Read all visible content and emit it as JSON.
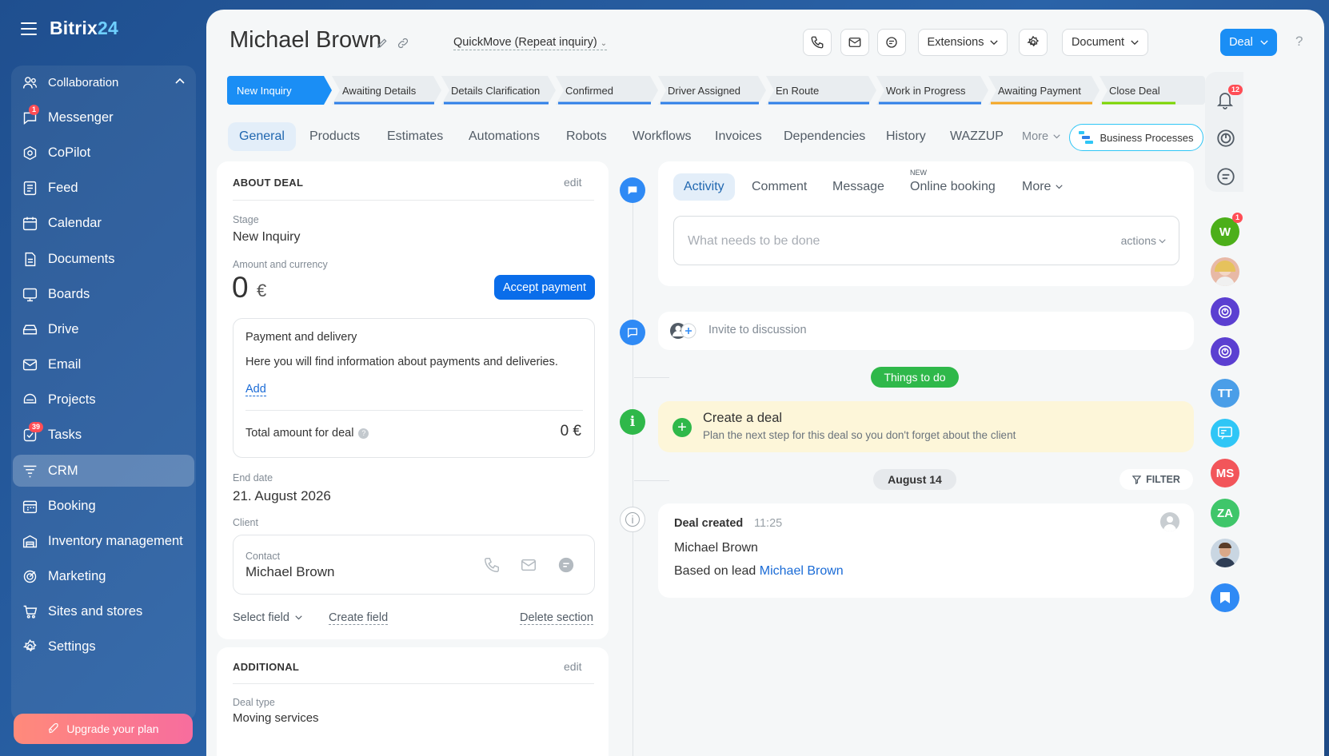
{
  "app": {
    "logo_text": "Bitrix24",
    "logo_main": "Bitrix",
    "logo_num": "24"
  },
  "sidebar": {
    "group_label": "Collaboration",
    "items": [
      {
        "label": "Messenger",
        "badge": "1"
      },
      {
        "label": "CoPilot"
      },
      {
        "label": "Feed"
      },
      {
        "label": "Calendar"
      },
      {
        "label": "Documents"
      },
      {
        "label": "Boards"
      },
      {
        "label": "Drive"
      },
      {
        "label": "Email"
      },
      {
        "label": "Projects"
      },
      {
        "label": "Tasks",
        "badge": "39"
      },
      {
        "label": "CRM"
      },
      {
        "label": "Booking"
      },
      {
        "label": "Inventory management"
      },
      {
        "label": "Marketing"
      },
      {
        "label": "Sites and stores"
      },
      {
        "label": "Settings"
      }
    ],
    "upgrade_label": "Upgrade your plan"
  },
  "header": {
    "title": "Michael Brown",
    "category": "QuickMove (Repeat inquiry)",
    "extensions_label": "Extensions",
    "document_label": "Document",
    "deal_label": "Deal",
    "help": "?"
  },
  "stages": [
    {
      "label": "New Inquiry",
      "color": "#1a8ef5",
      "active": true
    },
    {
      "label": "Awaiting Details",
      "color": "#2f80e8"
    },
    {
      "label": "Details Clarification",
      "color": "#2f80e8"
    },
    {
      "label": "Confirmed",
      "color": "#2f80e8"
    },
    {
      "label": "Driver Assigned",
      "color": "#2f80e8"
    },
    {
      "label": "En Route",
      "color": "#2f80e8"
    },
    {
      "label": "Work in Progress",
      "color": "#2f80e8"
    },
    {
      "label": "Awaiting Payment",
      "color": "#f5a623"
    },
    {
      "label": "Close Deal",
      "color": "#7bd500"
    }
  ],
  "tabs": [
    {
      "label": "General"
    },
    {
      "label": "Products"
    },
    {
      "label": "Estimates"
    },
    {
      "label": "Automations"
    },
    {
      "label": "Robots"
    },
    {
      "label": "Workflows"
    },
    {
      "label": "Invoices"
    },
    {
      "label": "Dependencies"
    },
    {
      "label": "History"
    },
    {
      "label": "WAZZUP"
    },
    {
      "label": "More"
    }
  ],
  "business_processes_label": "Business Processes",
  "about": {
    "section_title": "ABOUT DEAL",
    "edit_label": "edit",
    "stage_label": "Stage",
    "stage_value": "New Inquiry",
    "amount_label": "Amount and currency",
    "amount_value": "0",
    "currency": "€",
    "accept_label": "Accept payment",
    "payment_title": "Payment and delivery",
    "payment_desc": "Here you will find information about payments and deliveries.",
    "add_label": "Add",
    "total_label": "Total amount for deal",
    "total_value": "0 €",
    "end_date_label": "End date",
    "end_date_value": "21. August 2026",
    "client_label": "Client",
    "contact_label": "Contact",
    "contact_name": "Michael Brown",
    "select_field_label": "Select field",
    "create_field_label": "Create field",
    "delete_section_label": "Delete section"
  },
  "additional": {
    "section_title": "ADDITIONAL",
    "edit_label": "edit",
    "deal_type_label": "Deal type",
    "deal_type_value": "Moving services"
  },
  "activity": {
    "tabs": [
      {
        "label": "Activity"
      },
      {
        "label": "Comment"
      },
      {
        "label": "Message"
      },
      {
        "label": "Online booking",
        "tag": "NEW"
      },
      {
        "label": "More"
      }
    ],
    "placeholder": "What needs to be done",
    "actions_label": "actions",
    "invite_label": "Invite to discussion",
    "things_label": "Things to do",
    "create_title": "Create a deal",
    "create_desc": "Plan the next step for this deal so you don't forget about the client",
    "date_label": "August 14",
    "filter_label": "FILTER",
    "event_title": "Deal created",
    "event_time": "11:25",
    "event_person": "Michael Brown",
    "event_based": "Based on lead",
    "event_link": "Michael Brown"
  },
  "rail": {
    "notifications_badge": "12",
    "avatars": [
      {
        "initials": "W",
        "color": "#4caf1a",
        "badge": "1"
      },
      {
        "initials": "",
        "color": "#e8b9a6",
        "type": "photo"
      },
      {
        "initials": "",
        "color": "#5b3fd1",
        "type": "copilot"
      },
      {
        "initials": "",
        "color": "#5b3fd1",
        "type": "copilot"
      },
      {
        "initials": "TT",
        "color": "#4a9ee8"
      },
      {
        "initials": "",
        "color": "#2fc6f6",
        "type": "chat"
      },
      {
        "initials": "MS",
        "color": "#f2555a"
      },
      {
        "initials": "ZA",
        "color": "#3fc66a"
      },
      {
        "initials": "",
        "color": "#7a5a40",
        "type": "photo2"
      },
      {
        "initials": "",
        "color": "#2f8af5",
        "type": "bookmark"
      }
    ]
  }
}
